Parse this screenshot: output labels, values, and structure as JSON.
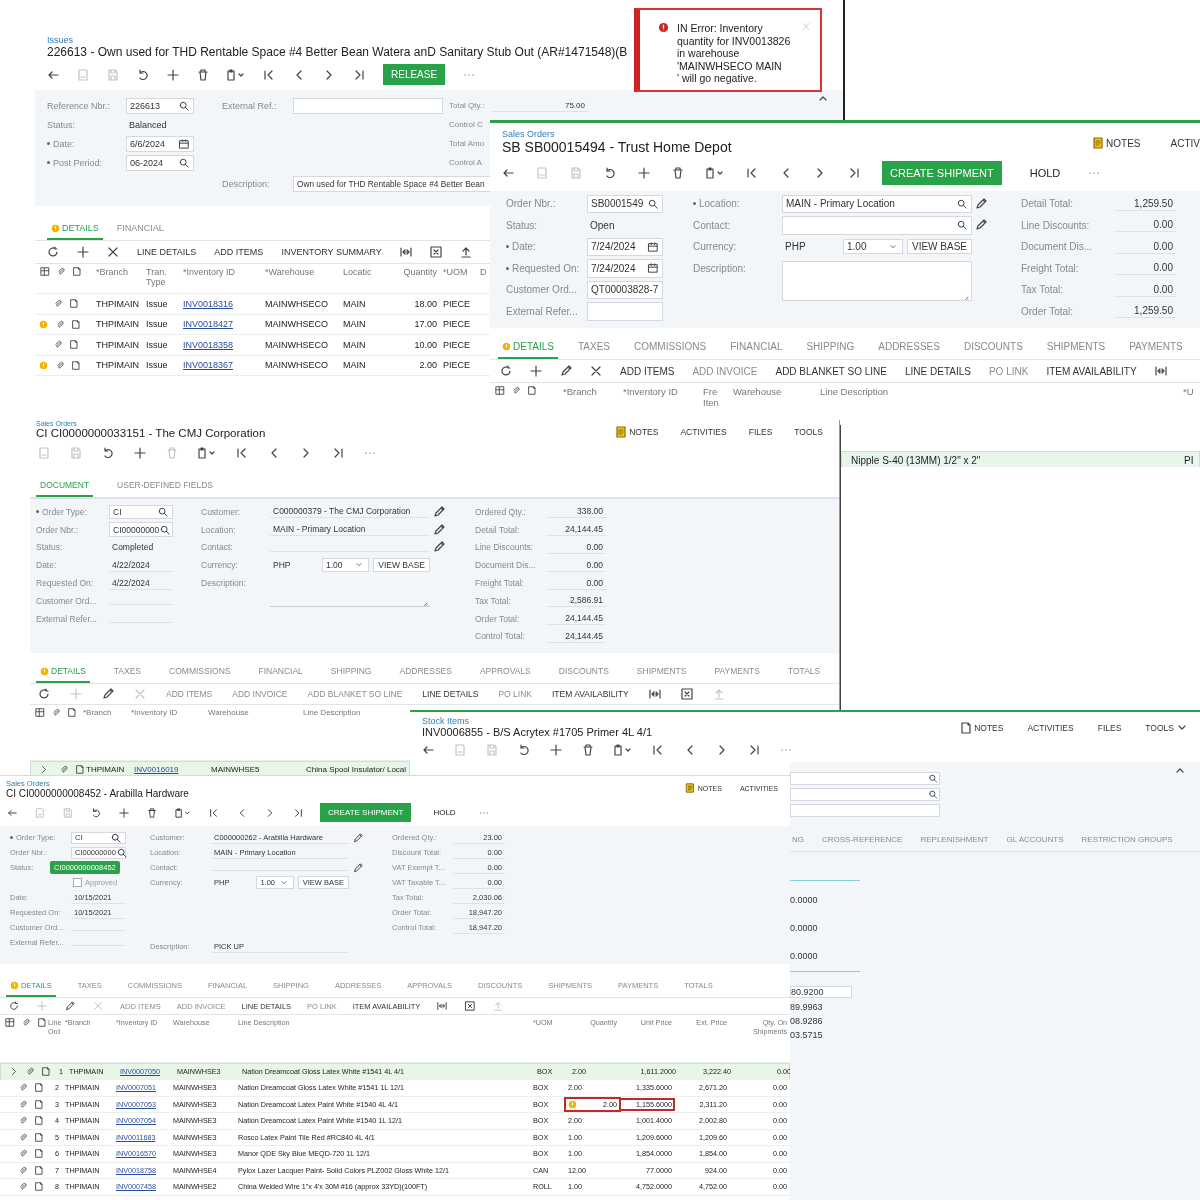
{
  "issue_window": {
    "breadcrumb": "Issues",
    "title": "226613 - Own used for THD Rentable Space #4 Better Bean Watera anD Sanitary Stub Out (AR#1471548)(B",
    "actions": [
      {
        "label": "RELEASE",
        "primary": true
      }
    ],
    "form": [
      [
        {
          "label": "Reference Nbr.:",
          "value": "226613",
          "kind": "lookup",
          "required": false
        },
        {
          "label": "Status:",
          "value": "Balanced",
          "kind": "text",
          "required": false
        },
        {
          "label": "Date:",
          "value": "6/6/2024",
          "kind": "date",
          "required": true
        },
        {
          "label": "Post Period:",
          "value": "06-2024",
          "kind": "lookup",
          "required": true
        }
      ],
      [
        {
          "label": "External Ref.:",
          "kind": "input",
          "required": false
        },
        {
          "label": "Description:",
          "value": "Own used for THD Rentable Space #4 Better Bean",
          "kind": "input",
          "required": false
        }
      ],
      [
        {
          "label": "Total Qty.:",
          "value": "75.00",
          "kind": "number",
          "required": false
        },
        {
          "label": "Control C",
          "kind": "label",
          "required": false
        },
        {
          "label": "Total Amo",
          "kind": "label",
          "required": false
        },
        {
          "label": "Control A",
          "kind": "label",
          "required": false
        }
      ]
    ],
    "tabs": [
      {
        "label": "DETAILS",
        "selected": true,
        "warning": true
      },
      {
        "label": "FINANCIAL",
        "selected": false,
        "warning": false
      }
    ],
    "grid_toolbar": {
      "edit_disabled": false,
      "buttons": [
        {
          "label": "LINE DETAILS",
          "disabled": false
        },
        {
          "label": "ADD ITEMS",
          "disabled": false
        },
        {
          "label": "INVENTORY SUMMARY",
          "disabled": false
        }
      ]
    },
    "grid": {
      "columns": [
        {
          "label": "*Branch",
          "kind": "text"
        },
        {
          "label": "Tran. Type",
          "kind": "text"
        },
        {
          "label": "*Inventory ID",
          "kind": "link"
        },
        {
          "label": "*Warehouse",
          "kind": "text"
        },
        {
          "label": "Locatic",
          "kind": "text"
        },
        {
          "label": "Quantity",
          "kind": "number"
        },
        {
          "label": "*UOM",
          "kind": "text"
        },
        {
          "label": "D",
          "kind": "text"
        }
      ],
      "rows": [
        {
          "warning": false,
          "selected": false,
          "highlighted": false,
          "cells": [
            "THPIMAIN",
            "Issue",
            "INV0018316",
            "MAINWHSECO",
            "MAIN",
            "18.00",
            "PIECE"
          ]
        },
        {
          "warning": true,
          "selected": false,
          "highlighted": false,
          "cells": [
            "THPIMAIN",
            "Issue",
            "INV0018427",
            "MAINWHSECO",
            "MAIN",
            "17.00",
            "PIECE"
          ]
        },
        {
          "warning": false,
          "selected": false,
          "highlighted": false,
          "cells": [
            "THPIMAIN",
            "Issue",
            "INV0018358",
            "MAINWHSECO",
            "MAIN",
            "10.00",
            "PIECE"
          ]
        },
        {
          "warning": true,
          "selected": false,
          "highlighted": false,
          "cells": [
            "THPIMAIN",
            "Issue",
            "INV0018367",
            "MAINWHSECO",
            "MAIN",
            "2.00",
            "PIECE"
          ]
        }
      ]
    }
  },
  "error_toast": {
    "message": "IN Error: Inventory quantity for INV0013826 in warehouse 'MAINWHSECO MAIN       ' will go negative."
  },
  "sales_order_sb": {
    "breadcrumb": "Sales Orders",
    "title": "SB SB00015494 - Trust Home Depot",
    "header_links": [
      {
        "label": "NOTES",
        "kind": "notes"
      },
      {
        "label": "ACTIV",
        "kind": "plain"
      }
    ],
    "actions": [
      {
        "label": "CREATE SHIPMENT",
        "primary": true
      },
      {
        "label": "HOLD",
        "primary": false
      }
    ],
    "form": [
      [
        {
          "label": "Order Nbr.:",
          "value": "SB0001549",
          "kind": "lookup",
          "required": false
        },
        {
          "label": "Status:",
          "value": "Open",
          "kind": "text",
          "required": false
        },
        {
          "label": "Date:",
          "value": "7/24/2024",
          "kind": "date",
          "required": true
        },
        {
          "label": "Requested On:",
          "value": "7/24/2024",
          "kind": "date",
          "required": true
        },
        {
          "label": "Customer Ord...",
          "value": "QT00003828-7",
          "kind": "input",
          "required": false
        },
        {
          "label": "External Refer...",
          "kind": "input",
          "required": false
        }
      ],
      [
        {
          "label": "Location:",
          "value": "MAIN - Primary Location",
          "kind": "lookup_edit",
          "required": true
        },
        {
          "label": "Contact:",
          "kind": "lookup_edit",
          "required": false
        },
        {
          "label": "Currency:",
          "kind": "currency",
          "currency": "PHP",
          "rate": "1.00",
          "button": "VIEW BASE",
          "required": false
        },
        {
          "label": "Description:",
          "kind": "textarea",
          "required": false
        }
      ],
      [
        {
          "label": "Detail Total:",
          "value": "1,259.50",
          "kind": "number",
          "required": false
        },
        {
          "label": "Line Discounts:",
          "value": "0.00",
          "kind": "number",
          "required": false
        },
        {
          "label": "Document Dis...",
          "value": "0.00",
          "kind": "number",
          "required": false
        },
        {
          "label": "Freight Total:",
          "value": "0.00",
          "kind": "number",
          "required": false
        },
        {
          "label": "Tax Total:",
          "value": "0.00",
          "kind": "number",
          "required": false
        },
        {
          "label": "Order Total:",
          "value": "1,259.50",
          "kind": "number",
          "required": false
        }
      ]
    ],
    "tabs": [
      {
        "label": "DETAILS",
        "selected": true,
        "warning": true
      },
      {
        "label": "TAXES",
        "selected": false,
        "warning": false
      },
      {
        "label": "COMMISSIONS",
        "selected": false,
        "warning": false
      },
      {
        "label": "FINANCIAL",
        "selected": false,
        "warning": false
      },
      {
        "label": "SHIPPING",
        "selected": false,
        "warning": false
      },
      {
        "label": "ADDRESSES",
        "selected": false,
        "warning": false
      },
      {
        "label": "DISCOUNTS",
        "selected": false,
        "warning": false
      },
      {
        "label": "SHIPMENTS",
        "selected": false,
        "warning": false
      },
      {
        "label": "PAYMENTS",
        "selected": false,
        "warning": false
      }
    ],
    "grid_toolbar": {
      "edit_disabled": false,
      "buttons": [
        {
          "label": "ADD ITEMS",
          "disabled": false
        },
        {
          "label": "ADD INVOICE",
          "disabled": true
        },
        {
          "label": "ADD BLANKET SO LINE",
          "disabled": false
        },
        {
          "label": "LINE DETAILS",
          "disabled": false
        },
        {
          "label": "PO LINK",
          "disabled": true
        },
        {
          "label": "ITEM AVAILABILITY",
          "disabled": false
        }
      ]
    },
    "grid": {
      "columns": [
        {
          "label": "*Branch"
        },
        {
          "label": "*Inventory ID"
        },
        {
          "label": "Fre Iten"
        },
        {
          "label": "Warehouse"
        },
        {
          "label": "Line Description"
        },
        {
          "label": "*U"
        }
      ]
    }
  },
  "sb_grid_tail": {
    "rows": [
      {
        "selected": true,
        "cells": [
          "Nipple S-40 (13MM) 1/2\" x 2\"",
          "PI"
        ]
      }
    ]
  },
  "cmj_order": {
    "breadcrumb": "Sales Orders",
    "title": "CI CI0000000033151 - The CMJ Corporation",
    "header_links": [
      {
        "label": "NOTES",
        "kind": "notes"
      },
      {
        "label": "ACTIVITIES",
        "kind": "plain"
      },
      {
        "label": "FILES",
        "kind": "plain"
      },
      {
        "label": "TOOLS",
        "kind": "plain"
      }
    ],
    "top_tabs": [
      {
        "label": "DOCUMENT",
        "selected": true,
        "warning": false
      },
      {
        "label": "USER-DEFINED FIELDS",
        "selected": false,
        "warning": false
      }
    ],
    "form": [
      [
        {
          "label": "Order Type:",
          "value": "CI",
          "kind": "lookup",
          "required": true
        },
        {
          "label": "Order Nbr.:",
          "value": "CI00000000",
          "kind": "lookup",
          "required": false
        },
        {
          "label": "Status:",
          "value": "Completed",
          "kind": "text",
          "required": false
        },
        {
          "label": "Date:",
          "value": "4/22/2024",
          "kind": "line",
          "required": false
        },
        {
          "label": "Requested On:",
          "value": "4/22/2024",
          "kind": "line",
          "required": false
        },
        {
          "label": "Customer Ord...",
          "kind": "line",
          "required": false
        },
        {
          "label": "External Refer...",
          "kind": "line",
          "required": false
        }
      ],
      [
        {
          "label": "Customer:",
          "value": "C000000379 - The CMJ Corporation",
          "kind": "edit",
          "required": false
        },
        {
          "label": "Location:",
          "value": "MAIN - Primary Location",
          "kind": "edit",
          "required": false
        },
        {
          "label": "Contact:",
          "kind": "edit",
          "required": false
        },
        {
          "label": "Currency:",
          "kind": "currency",
          "currency": "PHP",
          "rate": "1.00",
          "button": "VIEW BASE",
          "required": false
        },
        {
          "label": "Description:",
          "kind": "textarea",
          "required": false
        }
      ],
      [
        {
          "label": "Ordered Qty.:",
          "value": "338.00",
          "kind": "number",
          "required": false
        },
        {
          "label": "Detail Total:",
          "value": "24,144.45",
          "kind": "number",
          "required": false
        },
        {
          "label": "Line Discounts:",
          "value": "0.00",
          "kind": "number",
          "required": false
        },
        {
          "label": "Document Dis...",
          "value": "0.00",
          "kind": "number",
          "required": false
        },
        {
          "label": "Freight Total:",
          "value": "0.00",
          "kind": "number",
          "required": false
        },
        {
          "label": "Tax Total:",
          "value": "2,586.91",
          "kind": "number",
          "required": false
        },
        {
          "label": "Order Total:",
          "value": "24,144.45",
          "kind": "number",
          "required": false
        },
        {
          "label": "Control Total:",
          "value": "24,144.45",
          "kind": "number",
          "required": false
        }
      ]
    ],
    "tabs": [
      {
        "label": "DETAILS",
        "selected": true,
        "warning": true
      },
      {
        "label": "TAXES",
        "selected": false,
        "warning": false
      },
      {
        "label": "COMMISSIONS",
        "selected": false,
        "warning": false
      },
      {
        "label": "FINANCIAL",
        "selected": false,
        "warning": false
      },
      {
        "label": "SHIPPING",
        "selected": false,
        "warning": false
      },
      {
        "label": "ADDRESSES",
        "selected": false,
        "warning": false
      },
      {
        "label": "APPROVALS",
        "selected": false,
        "warning": false
      },
      {
        "label": "DISCOUNTS",
        "selected": false,
        "warning": false
      },
      {
        "label": "SHIPMENTS",
        "selected": false,
        "warning": false
      },
      {
        "label": "PAYMENTS",
        "selected": false,
        "warning": false
      },
      {
        "label": "TOTALS",
        "selected": false,
        "warning": false
      }
    ],
    "grid_toolbar": {
      "edit_disabled": true,
      "buttons": [
        {
          "label": "ADD ITEMS",
          "disabled": true
        },
        {
          "label": "ADD INVOICE",
          "disabled": true
        },
        {
          "label": "ADD BLANKET SO LINE",
          "disabled": true
        },
        {
          "label": "LINE DETAILS",
          "disabled": false
        },
        {
          "label": "PO LINK",
          "disabled": true
        },
        {
          "label": "ITEM AVAILABILITY",
          "disabled": false
        }
      ]
    },
    "grid": {
      "columns": [
        {
          "label": "*Branch",
          "kind": "text"
        },
        {
          "label": "*Inventory ID",
          "kind": "link"
        },
        {
          "label": "Warehouse",
          "kind": "text"
        },
        {
          "label": "Line Description",
          "kind": "text"
        }
      ],
      "rows": [
        {
          "warning": false,
          "selected": true,
          "highlighted": false,
          "cells": [
            "THPIMAIN",
            "INV0016019",
            "MAINWHSE5",
            "China Spool Insulator/ Local"
          ]
        }
      ]
    }
  },
  "stock_item": {
    "breadcrumb": "Stock Items",
    "title": "INV0006855 - B/S Acrytex #1705 Primer 4L 4/1",
    "header_links": [
      {
        "label": "NOTES",
        "kind": "doc"
      },
      {
        "label": "ACTIVITIES",
        "kind": "plain"
      },
      {
        "label": "FILES",
        "kind": "plain"
      },
      {
        "label": "TOOLS",
        "kind": "menu"
      }
    ],
    "fields": [
      {
        "kind": "lookup"
      },
      {
        "kind": "lookup"
      },
      {
        "kind": "input"
      }
    ],
    "tabs": [
      {
        "label": "NG",
        "selected": false,
        "warning": false
      },
      {
        "label": "CROSS-REFERENCE",
        "selected": false,
        "warning": false
      },
      {
        "label": "REPLENISHMENT",
        "selected": false,
        "warning": false
      },
      {
        "label": "GL ACCOUNTS",
        "selected": false,
        "warning": false
      },
      {
        "label": "RESTRICTION GROUPS",
        "selected": false,
        "warning": false
      }
    ],
    "column_values": [
      "0.0000",
      "0.0000",
      "0.0000"
    ],
    "grid_values": [
      "80.9200",
      "89.9963",
      "08.9286",
      "03.5715"
    ]
  },
  "arabilla_order": {
    "breadcrumb": "Sales Orders",
    "title": "CI CI0000000008452 - Arabilla Hardware",
    "header_links": [
      {
        "label": "NOTES",
        "kind": "notes"
      },
      {
        "label": "ACTIVITIES",
        "kind": "plain"
      }
    ],
    "actions": [
      {
        "label": "CREATE SHIPMENT",
        "primary": true
      },
      {
        "label": "HOLD",
        "primary": false
      }
    ],
    "form": [
      [
        {
          "label": "Order Type:",
          "value": "CI",
          "kind": "lookup",
          "required": true
        },
        {
          "label": "Order Nbr.:",
          "value": "CI00000000",
          "kind": "lookup",
          "required": false,
          "tooltip": "CI0000000008452"
        },
        {
          "label": "Status:",
          "kind": "label",
          "required": false
        },
        {
          "value": "Approved",
          "kind": "checkbox",
          "checked": false
        },
        {
          "label": "Date:",
          "value": "10/15/2021",
          "kind": "line",
          "required": false
        },
        {
          "label": "Requested On:",
          "value": "10/15/2021",
          "kind": "line",
          "required": false
        },
        {
          "label": "Customer Ord...",
          "kind": "line",
          "required": false
        },
        {
          "label": "External Refer...",
          "kind": "line",
          "required": false
        }
      ],
      [
        {
          "label": "Customer:",
          "value": "C000000262 - Arabilla Hardware",
          "kind": "edit",
          "required": false
        },
        {
          "label": "Location:",
          "value": "MAIN - Primary Location",
          "kind": "line",
          "required": false
        },
        {
          "label": "Contact:",
          "kind": "edit",
          "required": false
        },
        {
          "label": "Currency:",
          "kind": "currency",
          "currency": "PHP",
          "rate": "1.00",
          "button": "VIEW BASE",
          "required": false
        },
        {
          "label": "Description:",
          "value": "PICK UP",
          "kind": "line",
          "required": false
        }
      ],
      [
        {
          "label": "Ordered Qty.:",
          "value": "23.00",
          "kind": "number",
          "required": false
        },
        {
          "label": "Discount Total:",
          "value": "0.00",
          "kind": "number",
          "required": false
        },
        {
          "label": "VAT Exempt T...",
          "value": "0.00",
          "kind": "number",
          "required": false
        },
        {
          "label": "VAT Taxable T...",
          "value": "0.00",
          "kind": "number",
          "required": false
        },
        {
          "label": "Tax Total:",
          "value": "2,030.06",
          "kind": "number",
          "required": false
        },
        {
          "label": "Order Total:",
          "value": "18,947.20",
          "kind": "number",
          "required": false
        },
        {
          "label": "Control Total:",
          "value": "18,947.20",
          "kind": "number",
          "required": false
        }
      ]
    ],
    "tabs": [
      {
        "label": "DETAILS",
        "selected": true,
        "warning": true
      },
      {
        "label": "TAXES",
        "selected": false,
        "warning": false
      },
      {
        "label": "COMMISSIONS",
        "selected": false,
        "warning": false
      },
      {
        "label": "FINANCIAL",
        "selected": false,
        "warning": false
      },
      {
        "label": "SHIPPING",
        "selected": false,
        "warning": false
      },
      {
        "label": "ADDRESSES",
        "selected": false,
        "warning": false
      },
      {
        "label": "APPROVALS",
        "selected": false,
        "warning": false
      },
      {
        "label": "DISCOUNTS",
        "selected": false,
        "warning": false
      },
      {
        "label": "SHIPMENTS",
        "selected": false,
        "warning": false
      },
      {
        "label": "PAYMENTS",
        "selected": false,
        "warning": false
      },
      {
        "label": "TOTALS",
        "selected": false,
        "warning": false
      }
    ],
    "grid_toolbar": {
      "edit_disabled": true,
      "buttons": [
        {
          "label": "ADD ITEMS",
          "disabled": true
        },
        {
          "label": "ADD INVOICE",
          "disabled": true
        },
        {
          "label": "LINE DETAILS",
          "disabled": false
        },
        {
          "label": "PO LINK",
          "disabled": true
        },
        {
          "label": "ITEM AVAILABILITY",
          "disabled": false
        }
      ]
    },
    "grid": {
      "columns": [
        {
          "label": "Line Ord",
          "kind": "number"
        },
        {
          "label": "*Branch",
          "kind": "text"
        },
        {
          "label": "*Inventory ID",
          "kind": "link"
        },
        {
          "label": "Warehouse",
          "kind": "text"
        },
        {
          "label": "Line Description",
          "kind": "text"
        },
        {
          "label": "*UOM",
          "kind": "text"
        },
        {
          "label": "Quantity",
          "kind": "number"
        },
        {
          "label": "Unit Price",
          "kind": "number"
        },
        {
          "label": "Ext. Price",
          "kind": "number"
        },
        {
          "label": "Qty. On Shipments",
          "kind": "number"
        }
      ],
      "rows": [
        {
          "warning": false,
          "selected": true,
          "highlighted": false,
          "cells": [
            "1",
            "THPIMAIN",
            "INV0007050",
            "MAINWHSE3",
            "Nation Dreamcoat Gloss Latex White #1541 4L 4/1",
            "BOX",
            "2.00",
            "1,611.2000",
            "3,222.40",
            "0.00"
          ]
        },
        {
          "warning": false,
          "selected": false,
          "highlighted": false,
          "cells": [
            "2",
            "THPIMAIN",
            "INV0007051",
            "MAINWHSE3",
            "Nation Dreamcoat Gloss Latex White #1541 1L 12/1",
            "BOX",
            "2.00",
            "1,335.6000",
            "2,671.20",
            "0.00"
          ]
        },
        {
          "warning": true,
          "selected": false,
          "highlighted": true,
          "cells": [
            "3",
            "THPIMAIN",
            "INV0007053",
            "MAINWHSE3",
            "Nation Dreamcoat Latex Paint White #1540 4L 4/1",
            "BOX",
            "2.00",
            "1,155.6000",
            "2,311.20",
            "0.00"
          ]
        },
        {
          "warning": false,
          "selected": false,
          "highlighted": false,
          "cells": [
            "4",
            "THPIMAIN",
            "INV0007054",
            "MAINWHSE3",
            "Nation Dreamcoat Latex Paint White #1540 1L 12/1",
            "BOX",
            "2.00",
            "1,001.4000",
            "2,002.80",
            "0.00"
          ]
        },
        {
          "warning": false,
          "selected": false,
          "highlighted": false,
          "cells": [
            "5",
            "THPIMAIN",
            "INV0011683",
            "MAINWHSE3",
            "Rosco Latex Paint Tile Red #RC840 4L 4/1",
            "BOX",
            "1.00",
            "1,209.6000",
            "1,209.60",
            "0.00"
          ]
        },
        {
          "warning": false,
          "selected": false,
          "highlighted": false,
          "cells": [
            "6",
            "THPIMAIN",
            "INV0016570",
            "MAINWHSE3",
            "Manor QDE Sky Blue MEQD-720 1L 12/1",
            "BOX",
            "1.00",
            "1,854.0000",
            "1,854.00",
            "0.00"
          ]
        },
        {
          "warning": false,
          "selected": false,
          "highlighted": false,
          "cells": [
            "7",
            "THPIMAIN",
            "INV0018758",
            "MAINWHSE4",
            "Pylox Lazer Lacquer Paint- Solid Colors PLZ002 Gloss White 12/1",
            "CAN",
            "12.00",
            "77.0000",
            "924.00",
            "0.00"
          ]
        },
        {
          "warning": false,
          "selected": false,
          "highlighted": false,
          "cells": [
            "8",
            "THPIMAIN",
            "INV0007458",
            "MAINWHSE2",
            "China Welded Wire 1\"x 4'x 30M #16 (approx 33YD)(100FT)",
            "ROLL",
            "1.00",
            "4,752.0000",
            "4,752.00",
            "0.00"
          ]
        }
      ]
    }
  }
}
